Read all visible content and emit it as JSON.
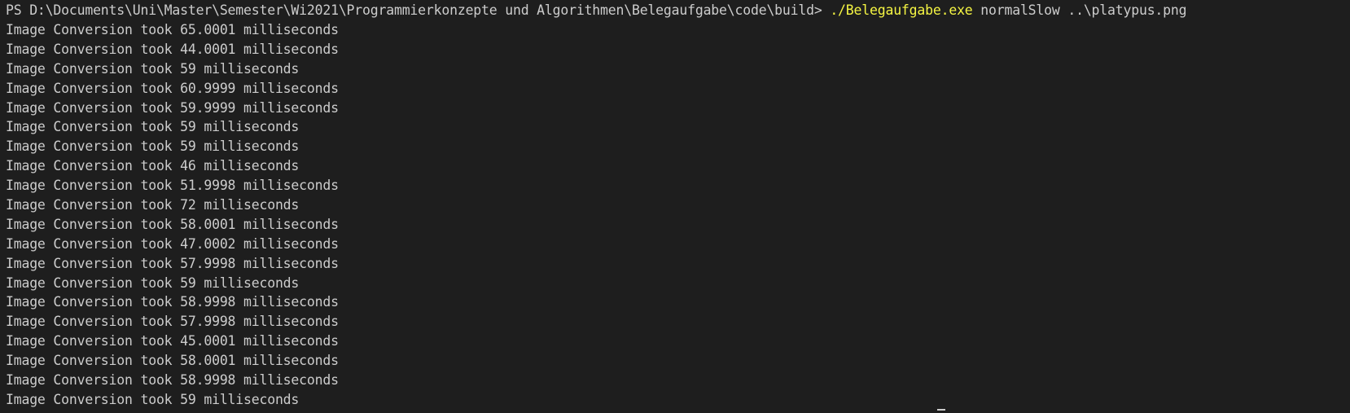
{
  "terminal": {
    "prompt": "PS D:\\Documents\\Uni\\Master\\Semester\\Wi2021\\Programmierkonzepte und Algorithmen\\Belegaufgabe\\code\\build> ",
    "command_exe": "./Belegaufgabe.exe",
    "command_args": " normalSlow ..\\platypus.png",
    "output_lines": [
      "Image Conversion took 65.0001 milliseconds",
      "Image Conversion took 44.0001 milliseconds",
      "Image Conversion took 59 milliseconds",
      "Image Conversion took 60.9999 milliseconds",
      "Image Conversion took 59.9999 milliseconds",
      "Image Conversion took 59 milliseconds",
      "Image Conversion took 59 milliseconds",
      "Image Conversion took 46 milliseconds",
      "Image Conversion took 51.9998 milliseconds",
      "Image Conversion took 72 milliseconds",
      "Image Conversion took 58.0001 milliseconds",
      "Image Conversion took 47.0002 milliseconds",
      "Image Conversion took 57.9998 milliseconds",
      "Image Conversion took 59 milliseconds",
      "Image Conversion took 58.9998 milliseconds",
      "Image Conversion took 57.9998 milliseconds",
      "Image Conversion took 45.0001 milliseconds",
      "Image Conversion took 58.0001 milliseconds",
      "Image Conversion took 58.9998 milliseconds",
      "Image Conversion took 59 milliseconds"
    ]
  },
  "colors": {
    "background": "#1e1e1e",
    "text": "#cccccc",
    "command_highlight": "#f5f543"
  }
}
